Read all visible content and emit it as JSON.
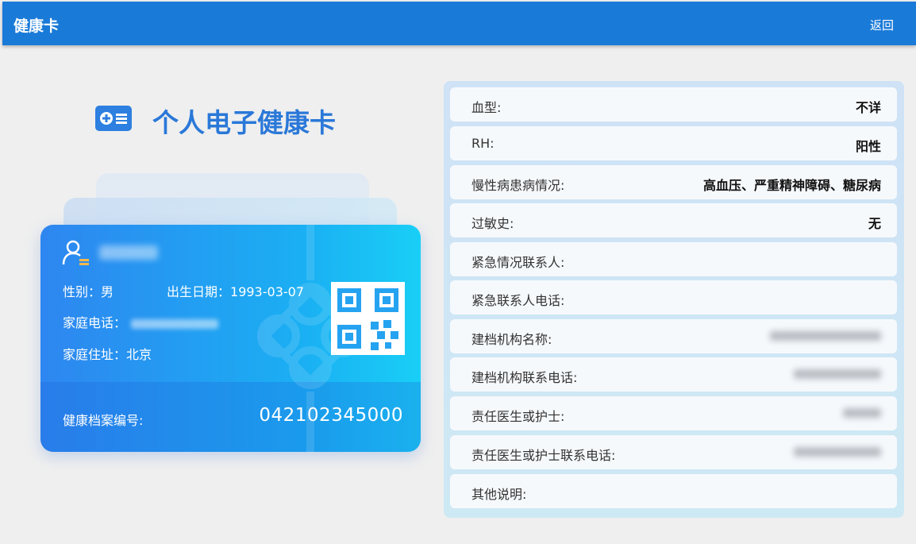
{
  "topbar": {
    "title": "健康卡",
    "back_label": "返回"
  },
  "heading": {
    "icon": "health-card-icon",
    "title": "个人电子健康卡"
  },
  "card": {
    "gender_label": "性别：",
    "gender_value": "男",
    "birth_label": "出生日期：",
    "birth_value": "1993-03-07",
    "phone_label": "家庭电话：",
    "address_label": "家庭住址：",
    "address_value": "北京",
    "archive_label": "健康档案编号:",
    "archive_no": "042102345000",
    "colors": {
      "start": "#2e86f0",
      "end": "#19cff6"
    }
  },
  "info": {
    "rows": [
      {
        "label": "血型:",
        "value": "不详"
      },
      {
        "label": "RH:",
        "value": "阳性"
      },
      {
        "label": "慢性病患病情况:",
        "value": "高血压、严重精神障碍、糖尿病"
      },
      {
        "label": "过敏史:",
        "value": "无"
      },
      {
        "label": "紧急情况联系人:",
        "value": ""
      },
      {
        "label": "紧急联系人电话:",
        "value": ""
      },
      {
        "label": "建档机构名称:",
        "value": ""
      },
      {
        "label": "建档机构联系电话:",
        "value": ""
      },
      {
        "label": "责任医生或护士:",
        "value": ""
      },
      {
        "label": "责任医生或护士联系电话:",
        "value": ""
      },
      {
        "label": "其他说明:",
        "value": ""
      }
    ]
  },
  "accent": "#1a7ad8"
}
